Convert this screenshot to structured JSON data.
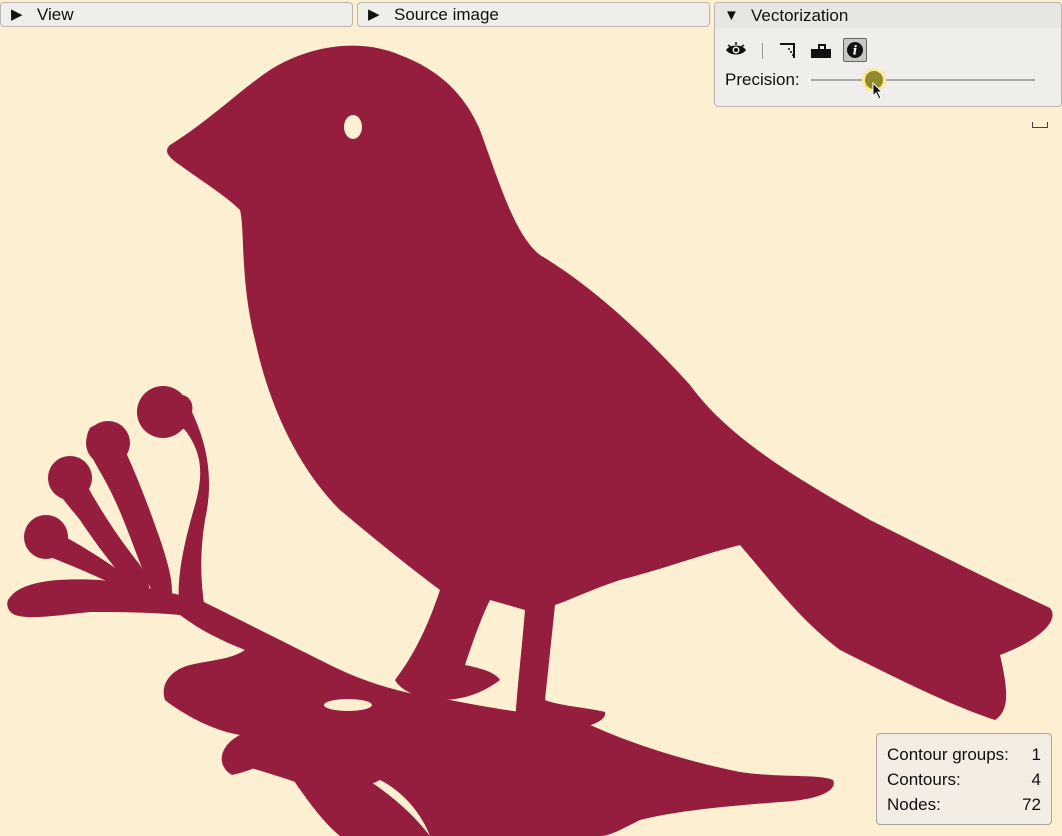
{
  "panels": {
    "view": {
      "label": "View",
      "expanded": false
    },
    "source_image": {
      "label": "Source image",
      "expanded": false
    },
    "vectorization": {
      "label": "Vectorization",
      "expanded": true,
      "toolbar": [
        "eye-icon",
        "corner-icon",
        "fill-icon",
        "info-icon"
      ],
      "active_tool": "info-icon",
      "precision": {
        "label": "Precision:",
        "value": 0.28
      }
    }
  },
  "stats": {
    "contour_groups_label": "Contour groups:",
    "contour_groups_value": "1",
    "contours_label": "Contours:",
    "contours_value": "4",
    "nodes_label": "Nodes:",
    "nodes_value": "72"
  },
  "colors": {
    "background": "#fdefd1",
    "shape_fill": "#951d3d",
    "panel_bg": "#f0eeea",
    "slider_knob": "#8f8a2a"
  }
}
